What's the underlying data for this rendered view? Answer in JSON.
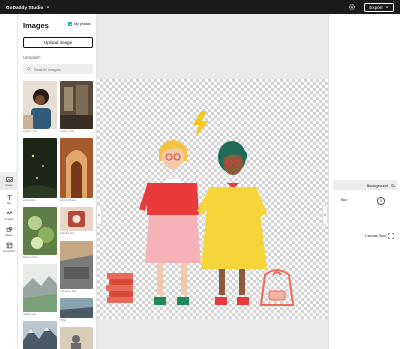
{
  "app": {
    "brand": "GoDaddy Studio",
    "export_label": "Export"
  },
  "rail": {
    "items": [
      {
        "label": "Image",
        "icon": "image-icon",
        "active": true
      },
      {
        "label": "Text",
        "icon": "text-icon",
        "active": false
      },
      {
        "label": "Graphic",
        "icon": "graphic-icon",
        "active": false
      },
      {
        "label": "Shape",
        "icon": "shape-icon",
        "active": false
      },
      {
        "label": "Templates",
        "icon": "templates-icon",
        "active": false
      }
    ]
  },
  "images_panel": {
    "title": "Images",
    "my_photos_label": "My photos",
    "upload_label": "Upload image",
    "section_label": "Unsplash",
    "search_placeholder": "Search images",
    "thumbnails": [
      {
        "caption": "Lesley Uwa",
        "colors": [
          "#e7dfd3",
          "#5a3a28"
        ]
      },
      {
        "caption": "Lesley Uwa",
        "colors": [
          "#5b4a3a",
          "#9b8a72"
        ]
      },
      {
        "caption": "Eddie Ellis",
        "colors": [
          "#1d2619",
          "#3d5a2c"
        ]
      },
      {
        "caption": "Elishiv Sayes",
        "colors": [
          "#a45a2d",
          "#e0a76a"
        ]
      },
      {
        "caption": "Darra Cross",
        "colors": [
          "#6a8e4d",
          "#b8d18c"
        ]
      },
      {
        "caption": "Nahidul Kim",
        "colors": [
          "#b6473b",
          "#e8d6c6"
        ]
      },
      {
        "caption": "Jinhee Lee",
        "colors": [
          "#e6ebe6",
          "#7aa07a"
        ]
      },
      {
        "caption": "Cameron Mai",
        "colors": [
          "#7a7a7a",
          "#c4a882"
        ]
      },
      {
        "caption": "Mario Cam",
        "colors": [
          "#8aa3b0",
          "#4a5a66"
        ]
      },
      {
        "caption": "Phlip",
        "colors": [
          "#c9b89a",
          "#6a6a6a"
        ]
      }
    ]
  },
  "properties": {
    "background_label": "Background",
    "blur_label": "Blur",
    "blur_value": "0",
    "canvas_size_label": "Canvas Size"
  }
}
